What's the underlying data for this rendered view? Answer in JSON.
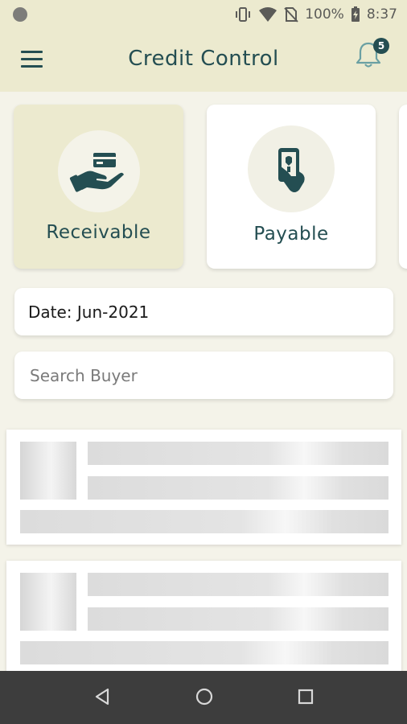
{
  "status_bar": {
    "battery": "100%",
    "time": "8:37"
  },
  "app_bar": {
    "title": "Credit Control",
    "notification_count": "5"
  },
  "tabs": [
    {
      "label": "Receivable",
      "icon": "hand-card-icon",
      "selected": true
    },
    {
      "label": "Payable",
      "icon": "hand-phone-icon",
      "selected": false
    }
  ],
  "date_field": {
    "text": "Date: Jun-2021"
  },
  "search": {
    "placeholder": "Search Buyer",
    "value": ""
  },
  "colors": {
    "accent": "#244e52",
    "header_bg": "#eceacf",
    "page_bg": "#f4f3e9"
  }
}
